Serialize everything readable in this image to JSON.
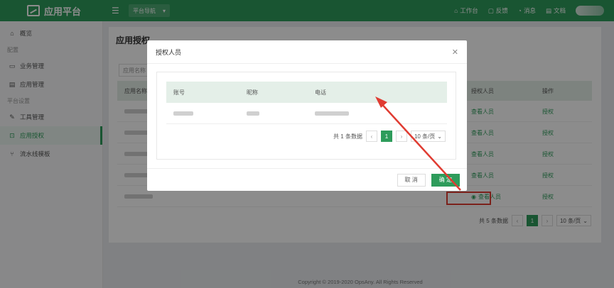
{
  "topbar": {
    "app_title": "应用平台",
    "nav_select": "平台导航",
    "links": [
      {
        "icon": "home-icon",
        "label": "工作台"
      },
      {
        "icon": "feedback-icon",
        "label": "反馈"
      },
      {
        "icon": "bell-icon",
        "label": "消息"
      },
      {
        "icon": "doc-icon",
        "label": "文档"
      }
    ]
  },
  "sidebar": {
    "overview": "概览",
    "group_config": "配置",
    "items_config": [
      "业务管理",
      "应用管理"
    ],
    "group_platform": "平台设置",
    "items_platform": [
      "工具管理",
      "应用授权",
      "流水线模板"
    ]
  },
  "main": {
    "title": "应用授权",
    "filter_placeholder": "应用名称",
    "columns": [
      "应用名称",
      "授权人员",
      "操作"
    ],
    "rows": [
      {
        "action1": "查看人员",
        "action2": "授权"
      },
      {
        "action1": "查看人员",
        "action2": "授权"
      },
      {
        "action1": "查看人员",
        "action2": "授权"
      },
      {
        "action1": "查看人员",
        "action2": "授权"
      },
      {
        "action1": "查看人员",
        "action2": "授权"
      }
    ],
    "pager": {
      "total": "共 5 条数据",
      "current": "1",
      "size": "10 条/页"
    }
  },
  "modal": {
    "title": "授权人员",
    "columns": [
      "账号",
      "昵称",
      "电话"
    ],
    "pager": {
      "total": "共 1 条数据",
      "current": "1",
      "size": "10 条/页"
    },
    "cancel": "取 消",
    "confirm": "确 定"
  },
  "footer": "Copyright © 2019-2020 OpsAny. All Rights Reserved",
  "colors": {
    "primary": "#2e9c5b",
    "highlight": "#e03c32"
  }
}
